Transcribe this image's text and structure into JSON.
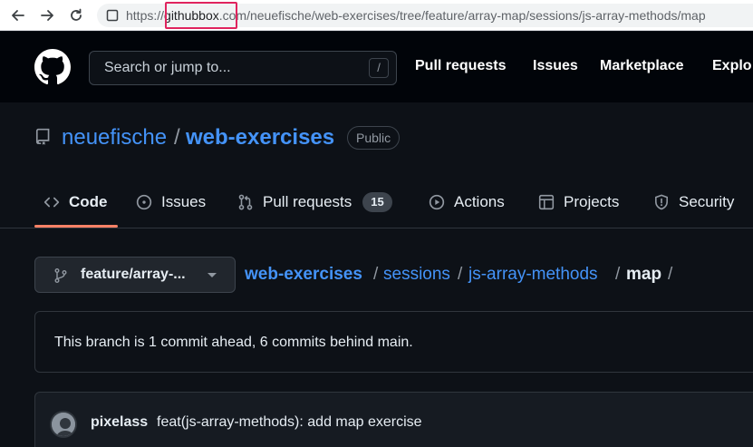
{
  "browser": {
    "url_scheme": "https://",
    "url_host": "githubbox",
    "url_rest": ".com/neuefische/web-exercises/tree/feature/array-map/sessions/js-array-methods/map"
  },
  "header": {
    "search_placeholder": "Search or jump to...",
    "search_key": "/",
    "nav": [
      "Pull requests",
      "Issues",
      "Marketplace",
      "Explo"
    ]
  },
  "repo": {
    "owner": "neuefische",
    "separator": "/",
    "name": "web-exercises",
    "visibility": "Public"
  },
  "tabs": [
    {
      "label": "Code",
      "icon": "code-icon",
      "active": true
    },
    {
      "label": "Issues",
      "icon": "issue-opened-icon"
    },
    {
      "label": "Pull requests",
      "icon": "git-pull-request-icon",
      "count": "15"
    },
    {
      "label": "Actions",
      "icon": "play-icon"
    },
    {
      "label": "Projects",
      "icon": "table-icon"
    },
    {
      "label": "Security",
      "icon": "shield-icon"
    }
  ],
  "branch": {
    "label": "feature/array-...",
    "icon": "git-branch-icon"
  },
  "breadcrumb": {
    "items": [
      "web-exercises",
      "sessions",
      "js-array-methods"
    ],
    "current": "map",
    "separator": "/"
  },
  "branch_info": {
    "text": "This branch is 1 commit ahead, 6 commits behind main."
  },
  "commit": {
    "author": "pixelass",
    "message": "feat(js-array-methods): add map exercise"
  },
  "colors": {
    "link": "#4493f8",
    "tab_underline": "#f78166",
    "background": "#0d1117",
    "header_bg": "#010409",
    "url_highlight": "#e0245e"
  }
}
